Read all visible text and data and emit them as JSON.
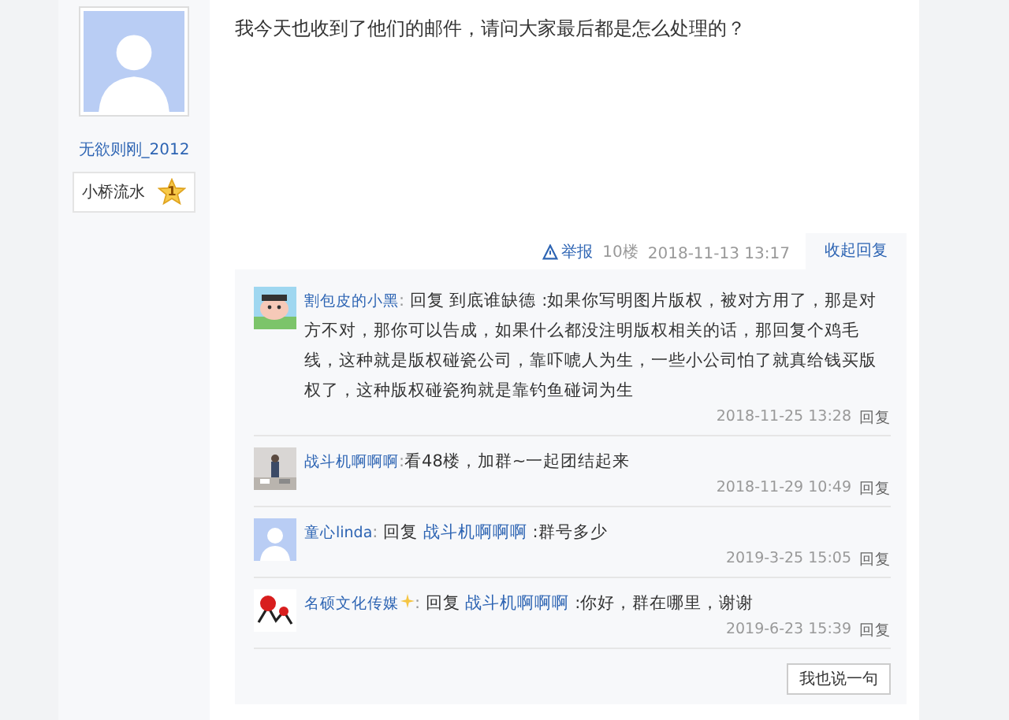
{
  "author": {
    "name": "无欲则刚_2012",
    "rank": "小桥流水",
    "rank_level": "1"
  },
  "post": {
    "text": "我今天也收到了他们的邮件，请问大家最后都是怎么处理的？",
    "report": "举报",
    "floor": "10楼",
    "time": "2018-11-13 13:17",
    "toggle": "收起回复"
  },
  "comments": [
    {
      "kind": "cartoon",
      "name": "割包皮的小黑",
      "badge": false,
      "lead": ":",
      "reply_prefix": "回复",
      "reply_target": "到底谁缺德",
      "reply_target_linked": false,
      "text": ":如果你写明图片版权，被对方用了，那是对方不对，那你可以告成，如果什么都没注明版权相关的话，那回复个鸡毛线，这种就是版权碰瓷公司，靠吓唬人为生，一些小公司怕了就真给钱买版权了，这种版权碰瓷狗就是靠钓鱼碰词为生",
      "time": "2018-11-25 13:28",
      "reply": "回复"
    },
    {
      "name": "战斗机啊啊啊",
      "badge": false,
      "lead": ":",
      "text": "看48楼，加群~一起团结起来",
      "time": "2018-11-29 10:49",
      "reply": "回复"
    },
    {
      "kind": "default",
      "name": "童心linda",
      "badge": false,
      "lead": ":",
      "reply_prefix": "回复",
      "reply_target": "战斗机啊啊啊",
      "reply_target_linked": true,
      "text": ":群号多少",
      "time": "2019-3-25 15:05",
      "reply": "回复"
    },
    {
      "kind": "logo",
      "name": "名硕文化传媒",
      "badge": true,
      "lead": ":",
      "reply_prefix": "回复",
      "reply_target": "战斗机啊啊啊",
      "reply_target_linked": true,
      "text": ":你好，群在哪里，谢谢",
      "time": "2019-6-23 15:39",
      "reply": "回复"
    }
  ],
  "say_button": "我也说一句"
}
